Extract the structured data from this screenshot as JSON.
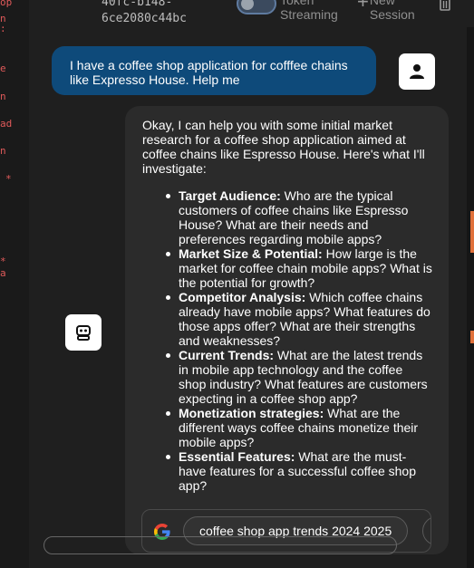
{
  "code_strip": [
    "op",
    "n",
    ":",
    "e",
    "n",
    "ad",
    "n",
    "*",
    "*",
    "a"
  ],
  "topbar": {
    "session_id": "40fc-b148-\n6ce2080c44bc",
    "toggle_label": "Token\nStreaming",
    "new_session_label": "New\nSession"
  },
  "user_message": "I have a coffee shop application for cofffee chains like Expresso House. Help me",
  "bot_message": {
    "intro": "Okay, I can help you with some initial market research for a coffee shop application aimed at coffee chains like Espresso House. Here's what I'll investigate:",
    "items": [
      {
        "title": "Target Audience:",
        "text": " Who are the typical customers of coffee chains like Espresso House? What are their needs and preferences regarding mobile apps?"
      },
      {
        "title": "Market Size & Potential:",
        "text": " How large is the market for coffee chain mobile apps? What is the potential for growth?"
      },
      {
        "title": "Competitor Analysis:",
        "text": " Which coffee chains already have mobile apps? What features do those apps offer? What are their strengths and weaknesses?"
      },
      {
        "title": "Current Trends:",
        "text": " What are the latest trends in mobile app technology and the coffee shop industry? What features are customers expecting in a coffee shop app?"
      },
      {
        "title": "Monetization strategies:",
        "text": " What are the different ways coffee chains monetize their mobile apps?"
      },
      {
        "title": "Essential Features:",
        "text": " What are the must-have features for a successful coffee shop app?"
      }
    ]
  },
  "search_suggestion": "coffee shop app trends 2024 2025",
  "colors": {
    "user_bubble": "#0e4a7a",
    "bot_bubble": "#2b2b2b",
    "background": "#1f1f1f"
  }
}
